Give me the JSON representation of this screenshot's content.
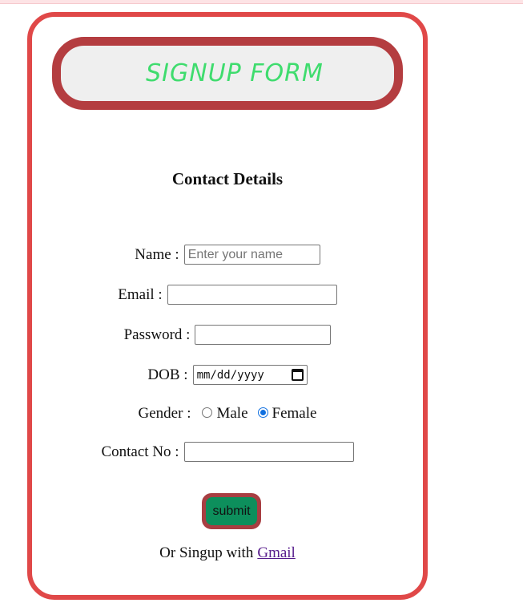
{
  "header": {
    "title": "SIGNUP FORM"
  },
  "section": {
    "title": "Contact Details"
  },
  "form": {
    "name_label": "Name :",
    "name_placeholder": "Enter your name",
    "email_label": "Email :",
    "password_label": "Password :",
    "dob_label": "DOB :",
    "dob_placeholder": "mm/dd/yyyy",
    "gender_label": "Gender :",
    "gender_options": [
      "Male",
      "Female"
    ],
    "gender_selected": "Female",
    "contact_label": "Contact No :",
    "submit_label": "submit"
  },
  "footer": {
    "prefix": "Or Singup with",
    "link_text": "Gmail"
  },
  "colors": {
    "card_border": "#e04848",
    "pill_border": "#b43d40",
    "title_green": "#3fdc6e",
    "submit_bg": "#0d8f5c",
    "radio_blue": "#0f6fe0"
  }
}
